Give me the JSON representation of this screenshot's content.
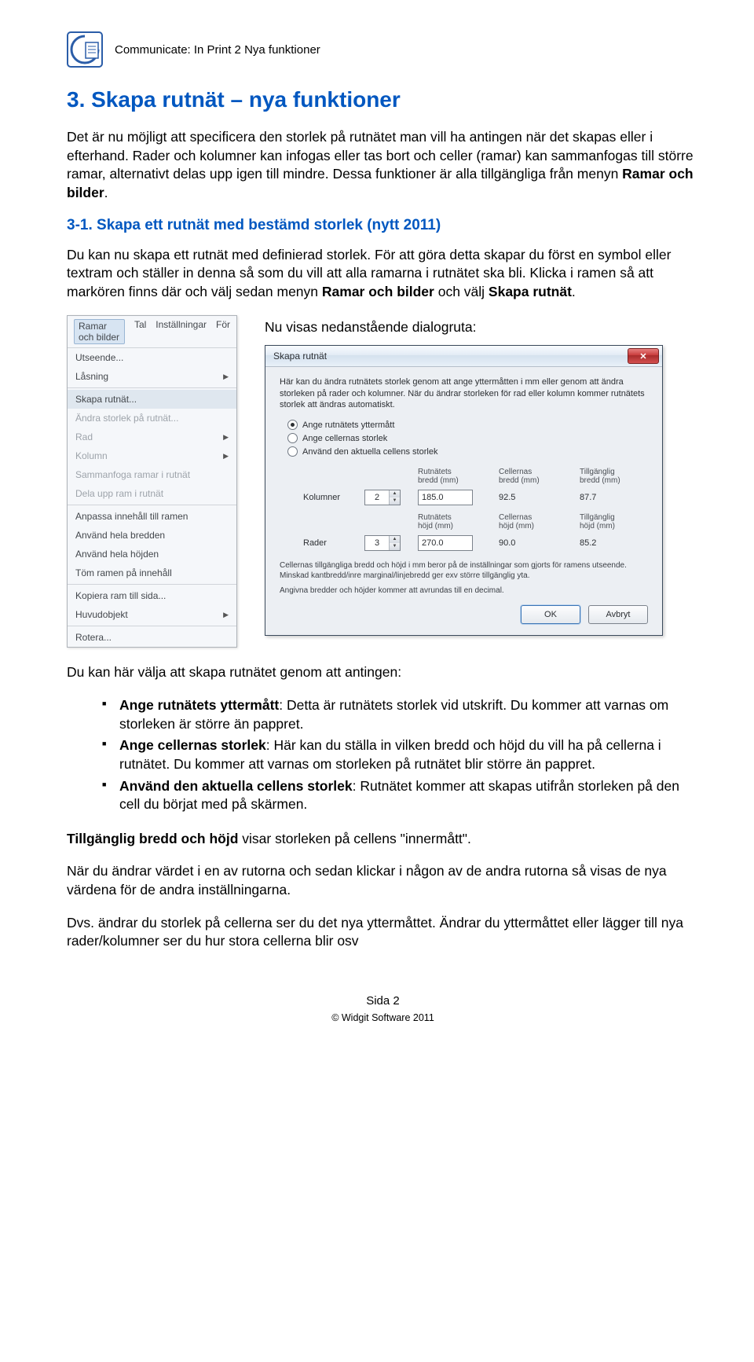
{
  "header": {
    "doc_title": "Communicate: In Print 2 Nya funktioner"
  },
  "section": {
    "title": "3. Skapa rutnät – nya funktioner",
    "intro_p1": "Det är nu möjligt att specificera den storlek på rutnätet man vill ha antingen när det skapas eller i efterhand. Rader och kolumner kan infogas eller tas bort och celler (ramar) kan sammanfogas till större ramar, alternativt delas upp igen till mindre. Dessa funktioner är alla tillgängliga från menyn ",
    "intro_bold": "Ramar och bilder",
    "intro_tail": "."
  },
  "subsection": {
    "title": "3-1. Skapa ett rutnät med bestämd storlek (nytt 2011)",
    "p_part1": "Du kan nu skapa ett rutnät med definierad storlek. För att göra detta skapar du först en symbol eller textram och ställer in denna så som du vill att alla ramarna i rutnätet ska bli. Klicka i ramen så att markören finns där och välj sedan menyn ",
    "p_bold1": "Ramar och bilder",
    "p_mid": " och välj  ",
    "p_bold2": "Skapa rutnät",
    "p_tail": "."
  },
  "figcaption": "Nu visas nedanstående dialogruta:",
  "menu": {
    "bar": {
      "item1": "Ramar och bilder",
      "item2": "Tal",
      "item3": "Inställningar",
      "item4": "För"
    },
    "items": [
      {
        "label": "Utseende...",
        "sub": false,
        "disabled": false
      },
      {
        "label": "Låsning",
        "sub": true,
        "disabled": false
      },
      {
        "sep": true
      },
      {
        "label": "Skapa rutnät...",
        "sub": false,
        "disabled": false,
        "selected": true
      },
      {
        "label": "Ändra storlek på rutnät...",
        "sub": false,
        "disabled": true
      },
      {
        "label": "Rad",
        "sub": true,
        "disabled": true
      },
      {
        "label": "Kolumn",
        "sub": true,
        "disabled": true
      },
      {
        "label": "Sammanfoga ramar i rutnät",
        "sub": false,
        "disabled": true
      },
      {
        "label": "Dela upp ram i rutnät",
        "sub": false,
        "disabled": true
      },
      {
        "sep": true
      },
      {
        "label": "Anpassa innehåll till ramen",
        "sub": false,
        "disabled": false
      },
      {
        "label": "Använd hela bredden",
        "sub": false,
        "disabled": false
      },
      {
        "label": "Använd hela höjden",
        "sub": false,
        "disabled": false
      },
      {
        "label": "Töm ramen på innehåll",
        "sub": false,
        "disabled": false
      },
      {
        "sep": true
      },
      {
        "label": "Kopiera ram till sida...",
        "sub": false,
        "disabled": false
      },
      {
        "label": "Huvudobjekt",
        "sub": true,
        "disabled": false
      },
      {
        "sep": true
      },
      {
        "label": "Rotera...",
        "sub": false,
        "disabled": false
      }
    ]
  },
  "dialog": {
    "title": "Skapa rutnät",
    "desc": "Här kan du ändra rutnätets storlek genom att ange yttermåtten i mm eller genom att ändra storleken på rader och kolumner. När du ändrar storleken för rad eller kolumn kommer rutnätets storlek att ändras automatiskt.",
    "radios": {
      "r1": "Ange rutnätets yttermått",
      "r2": "Ange cellernas storlek",
      "r3": "Använd den aktuella cellens storlek"
    },
    "colhead": {
      "c1": "",
      "c2": "",
      "c3a": "Rutnätets",
      "c3b": "bredd (mm)",
      "c4a": "Cellernas",
      "c4b": "bredd (mm)",
      "c5a": "Tillgänglig",
      "c5b": "bredd (mm)"
    },
    "row1": {
      "label": "Kolumner",
      "spin": "2",
      "a": "185.0",
      "b": "92.5",
      "c": "87.7"
    },
    "colhead2": {
      "c3a": "Rutnätets",
      "c3b": "höjd (mm)",
      "c4a": "Cellernas",
      "c4b": "höjd (mm)",
      "c5a": "Tillgänglig",
      "c5b": "höjd (mm)"
    },
    "row2": {
      "label": "Rader",
      "spin": "3",
      "a": "270.0",
      "b": "90.0",
      "c": "85.2"
    },
    "note1": "Cellernas tillgängliga bredd och höjd i mm beror på de inställningar som gjorts för ramens utseende. Minskad kantbredd/inre marginal/linjebredd ger exv större tillgänglig yta.",
    "note2": "Angivna bredder och höjder kommer att avrundas till en decimal.",
    "ok": "OK",
    "cancel": "Avbryt"
  },
  "after": {
    "lead": "Du kan här välja att skapa rutnätet genom att antingen:",
    "b1_bold": "Ange rutnätets yttermått",
    "b1_rest": ": Detta är rutnätets storlek vid utskrift. Du kommer att varnas om storleken är större än pappret.",
    "b2_bold": "Ange cellernas storlek",
    "b2_rest": ": Här kan du ställa in vilken bredd och höjd du vill ha på cellerna i rutnätet. Du kommer att varnas om storleken på rutnätet blir större än pappret.",
    "b3_bold": "Använd den aktuella cellens storlek",
    "b3_rest": ": Rutnätet kommer att skapas utifrån storleken på den cell du börjat med på skärmen.",
    "p2_bold": "Tillgänglig bredd och höjd",
    "p2_rest": " visar storleken på cellens \"innermått\".",
    "p3": "När du ändrar värdet i en av rutorna och sedan klickar i någon av de andra rutorna så visas de nya värdena för de andra inställningarna.",
    "p4": "Dvs. ändrar du storlek på cellerna ser du det nya yttermåttet. Ändrar du yttermåttet eller lägger till nya rader/kolumner ser du hur stora cellerna blir osv"
  },
  "footer": {
    "page": "Sida 2",
    "copy": "© Widgit Software 2011"
  }
}
